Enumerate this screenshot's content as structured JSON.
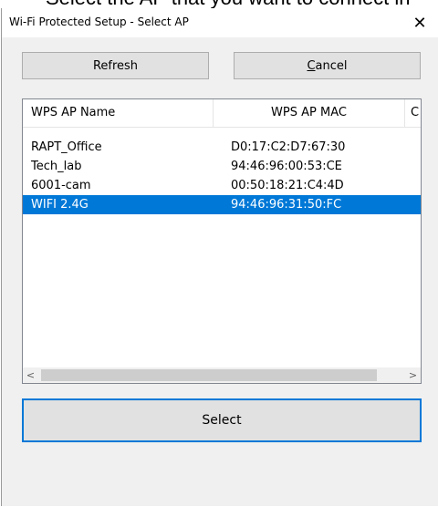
{
  "background_caption": "Select the AP that you want to connect in",
  "window": {
    "title": "Wi-Fi Protected Setup - Select AP",
    "close_glyph": "✕"
  },
  "buttons": {
    "refresh": "Refresh",
    "cancel_accel": "C",
    "cancel_rest": "ancel",
    "select": "Select"
  },
  "list": {
    "columns": [
      "WPS AP Name",
      "WPS AP MAC",
      "C"
    ],
    "rows": [
      {
        "name": "RAPT_Office",
        "mac": "D0:17:C2:D7:67:30",
        "selected": false
      },
      {
        "name": "Tech_lab",
        "mac": "94:46:96:00:53:CE",
        "selected": false
      },
      {
        "name": "6001-cam",
        "mac": "00:50:18:21:C4:4D",
        "selected": false
      },
      {
        "name": "WIFI 2.4G",
        "mac": "94:46:96:31:50:FC",
        "selected": true
      }
    ]
  },
  "scrollbar": {
    "left_arrow": "<",
    "right_arrow": ">"
  },
  "colors": {
    "selection": "#0078d7",
    "dialog_bg": "#f0f0f0"
  }
}
